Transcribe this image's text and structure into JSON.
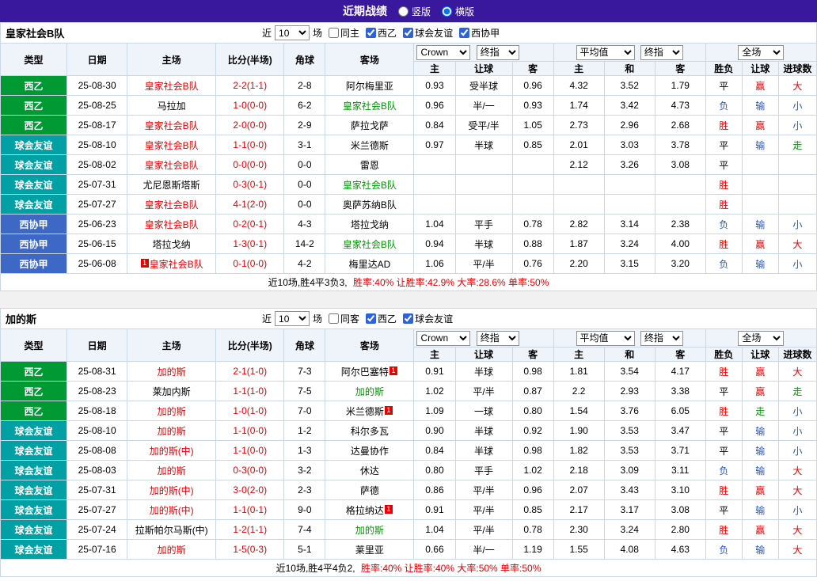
{
  "topbar": {
    "title": "近期战绩",
    "layout_options": [
      {
        "label": "竖版",
        "checked": false
      },
      {
        "label": "横版",
        "checked": true
      }
    ]
  },
  "filter_labels": {
    "near": "近",
    "games": "场"
  },
  "columns": {
    "type": "类型",
    "date": "日期",
    "home": "主场",
    "score": "比分(半场)",
    "corners": "角球",
    "away": "客场",
    "sub": [
      "主",
      "让球",
      "客",
      "主",
      "和",
      "客",
      "胜负",
      "让球",
      "进球数"
    ]
  },
  "header_controls": {
    "book": "Crown",
    "final": "终指",
    "average": "平均值",
    "full": "全场"
  },
  "colors": {
    "type_colors": {
      "西乙": "#009933",
      "球会友谊": "#00A0A5",
      "西协甲": "#3E68C6"
    },
    "palette": {
      "red": "#E60000",
      "blue": "#2255CC",
      "green": "#009900",
      "black": "#000000"
    },
    "outcome_color_map": {
      "胜": "red",
      "平": "black",
      "负": "blue",
      "赢": "red",
      "输": "blue",
      "走": "green",
      "大": "red",
      "小": "blue"
    }
  },
  "tables": [
    {
      "team": "皇家社会B队",
      "filter": {
        "games_value": "10",
        "same_label": "同主",
        "same_checked": false,
        "leagues": [
          {
            "label": "西乙",
            "checked": true
          },
          {
            "label": "球会友谊",
            "checked": true
          },
          {
            "label": "西协甲",
            "checked": true
          }
        ]
      },
      "rows": [
        {
          "type": "西乙",
          "date": "25-08-30",
          "home": {
            "name": "皇家社会B队",
            "focal": "home"
          },
          "score": "2-2(1-1)",
          "corners": "2-8",
          "away": {
            "name": "阿尔梅里亚"
          },
          "crown": [
            "0.93",
            "受半球",
            "0.96"
          ],
          "avg": [
            "4.32",
            "3.52",
            "1.79"
          ],
          "outcome": [
            "平",
            "赢",
            "大"
          ]
        },
        {
          "type": "西乙",
          "date": "25-08-25",
          "home": {
            "name": "马拉加"
          },
          "score": "1-0(0-0)",
          "corners": "6-2",
          "away": {
            "name": "皇家社会B队",
            "focal": "away"
          },
          "crown": [
            "0.96",
            "半/一",
            "0.93"
          ],
          "avg": [
            "1.74",
            "3.42",
            "4.73"
          ],
          "outcome": [
            "负",
            "输",
            "小"
          ]
        },
        {
          "type": "西乙",
          "date": "25-08-17",
          "home": {
            "name": "皇家社会B队",
            "focal": "home"
          },
          "score": "2-0(0-0)",
          "corners": "2-9",
          "away": {
            "name": "萨拉戈萨"
          },
          "crown": [
            "0.84",
            "受平/半",
            "1.05"
          ],
          "avg": [
            "2.73",
            "2.96",
            "2.68"
          ],
          "outcome": [
            "胜",
            "赢",
            "小"
          ]
        },
        {
          "type": "球会友谊",
          "date": "25-08-10",
          "home": {
            "name": "皇家社会B队",
            "focal": "home"
          },
          "score": "1-1(0-0)",
          "corners": "3-1",
          "away": {
            "name": "米兰德斯"
          },
          "crown": [
            "0.97",
            "半球",
            "0.85"
          ],
          "avg": [
            "2.01",
            "3.03",
            "3.78"
          ],
          "outcome": [
            "平",
            "输",
            "走"
          ]
        },
        {
          "type": "球会友谊",
          "date": "25-08-02",
          "home": {
            "name": "皇家社会B队",
            "focal": "home"
          },
          "score": "0-0(0-0)",
          "corners": "0-0",
          "away": {
            "name": "雷恩"
          },
          "crown": [
            "",
            "",
            ""
          ],
          "avg": [
            "2.12",
            "3.26",
            "3.08"
          ],
          "outcome": [
            "平",
            "",
            ""
          ]
        },
        {
          "type": "球会友谊",
          "date": "25-07-31",
          "home": {
            "name": "尤尼恩斯塔斯"
          },
          "score": "0-3(0-1)",
          "corners": "0-0",
          "away": {
            "name": "皇家社会B队",
            "focal": "away"
          },
          "crown": [
            "",
            "",
            ""
          ],
          "avg": [
            "",
            "",
            ""
          ],
          "outcome": [
            "胜",
            "",
            ""
          ]
        },
        {
          "type": "球会友谊",
          "date": "25-07-27",
          "home": {
            "name": "皇家社会B队",
            "focal": "home"
          },
          "score": "4-1(2-0)",
          "corners": "0-0",
          "away": {
            "name": "奥萨苏纳B队"
          },
          "crown": [
            "",
            "",
            ""
          ],
          "avg": [
            "",
            "",
            ""
          ],
          "outcome": [
            "胜",
            "",
            ""
          ]
        },
        {
          "type": "西协甲",
          "date": "25-06-23",
          "home": {
            "name": "皇家社会B队",
            "focal": "home"
          },
          "score": "0-2(0-1)",
          "corners": "4-3",
          "away": {
            "name": "塔拉戈纳"
          },
          "crown": [
            "1.04",
            "平手",
            "0.78"
          ],
          "avg": [
            "2.82",
            "3.14",
            "2.38"
          ],
          "outcome": [
            "负",
            "输",
            "小"
          ]
        },
        {
          "type": "西协甲",
          "date": "25-06-15",
          "home": {
            "name": "塔拉戈纳"
          },
          "score": "1-3(0-1)",
          "corners": "14-2",
          "away": {
            "name": "皇家社会B队",
            "focal": "away"
          },
          "crown": [
            "0.94",
            "半球",
            "0.88"
          ],
          "avg": [
            "1.87",
            "3.24",
            "4.00"
          ],
          "outcome": [
            "胜",
            "赢",
            "大"
          ]
        },
        {
          "type": "西协甲",
          "date": "25-06-08",
          "home": {
            "name": "皇家社会B队",
            "focal": "home",
            "badge": "1",
            "badge_pos": "before"
          },
          "score": "0-1(0-0)",
          "corners": "4-2",
          "away": {
            "name": "梅里达AD"
          },
          "crown": [
            "1.06",
            "平/半",
            "0.76"
          ],
          "avg": [
            "2.20",
            "3.15",
            "3.20"
          ],
          "outcome": [
            "负",
            "输",
            "小"
          ]
        }
      ],
      "footer": {
        "prefix": "近10场,胜4平3负3,",
        "stats": "胜率:40% 让胜率:42.9% 大率:28.6% 单率:50%"
      }
    },
    {
      "team": "加的斯",
      "filter": {
        "games_value": "10",
        "same_label": "同客",
        "same_checked": false,
        "leagues": [
          {
            "label": "西乙",
            "checked": true
          },
          {
            "label": "球会友谊",
            "checked": true
          }
        ]
      },
      "rows": [
        {
          "type": "西乙",
          "date": "25-08-31",
          "home": {
            "name": "加的斯",
            "focal": "home"
          },
          "score": "2-1(1-0)",
          "corners": "7-3",
          "away": {
            "name": "阿尔巴塞特",
            "badge": "1",
            "badge_pos": "after"
          },
          "crown": [
            "0.91",
            "半球",
            "0.98"
          ],
          "avg": [
            "1.81",
            "3.54",
            "4.17"
          ],
          "outcome": [
            "胜",
            "赢",
            "大"
          ]
        },
        {
          "type": "西乙",
          "date": "25-08-23",
          "home": {
            "name": "莱加内斯"
          },
          "score": "1-1(1-0)",
          "corners": "7-5",
          "away": {
            "name": "加的斯",
            "focal": "away"
          },
          "crown": [
            "1.02",
            "平/半",
            "0.87"
          ],
          "avg": [
            "2.2",
            "2.93",
            "3.38"
          ],
          "outcome": [
            "平",
            "赢",
            "走"
          ]
        },
        {
          "type": "西乙",
          "date": "25-08-18",
          "home": {
            "name": "加的斯",
            "focal": "home"
          },
          "score": "1-0(1-0)",
          "corners": "7-0",
          "away": {
            "name": "米兰德斯",
            "badge": "1",
            "badge_pos": "after"
          },
          "crown": [
            "1.09",
            "一球",
            "0.80"
          ],
          "avg": [
            "1.54",
            "3.76",
            "6.05"
          ],
          "outcome": [
            "胜",
            "走",
            "小"
          ]
        },
        {
          "type": "球会友谊",
          "date": "25-08-10",
          "home": {
            "name": "加的斯",
            "focal": "home"
          },
          "score": "1-1(0-0)",
          "corners": "1-2",
          "away": {
            "name": "科尔多瓦"
          },
          "crown": [
            "0.90",
            "半球",
            "0.92"
          ],
          "avg": [
            "1.90",
            "3.53",
            "3.47"
          ],
          "outcome": [
            "平",
            "输",
            "小"
          ]
        },
        {
          "type": "球会友谊",
          "date": "25-08-08",
          "home": {
            "name": "加的斯(中)",
            "focal": "home"
          },
          "score": "1-1(0-0)",
          "corners": "1-3",
          "away": {
            "name": "达曼协作"
          },
          "crown": [
            "0.84",
            "半球",
            "0.98"
          ],
          "avg": [
            "1.82",
            "3.53",
            "3.71"
          ],
          "outcome": [
            "平",
            "输",
            "小"
          ]
        },
        {
          "type": "球会友谊",
          "date": "25-08-03",
          "home": {
            "name": "加的斯",
            "focal": "home"
          },
          "score": "0-3(0-0)",
          "corners": "3-2",
          "away": {
            "name": "休达"
          },
          "crown": [
            "0.80",
            "平手",
            "1.02"
          ],
          "avg": [
            "2.18",
            "3.09",
            "3.11"
          ],
          "outcome": [
            "负",
            "输",
            "大"
          ]
        },
        {
          "type": "球会友谊",
          "date": "25-07-31",
          "home": {
            "name": "加的斯(中)",
            "focal": "home"
          },
          "score": "3-0(2-0)",
          "corners": "2-3",
          "away": {
            "name": "萨德"
          },
          "crown": [
            "0.86",
            "平/半",
            "0.96"
          ],
          "avg": [
            "2.07",
            "3.43",
            "3.10"
          ],
          "outcome": [
            "胜",
            "赢",
            "大"
          ]
        },
        {
          "type": "球会友谊",
          "date": "25-07-27",
          "home": {
            "name": "加的斯(中)",
            "focal": "home"
          },
          "score": "1-1(0-1)",
          "corners": "9-0",
          "away": {
            "name": "格拉纳达",
            "badge": "1",
            "badge_pos": "after"
          },
          "crown": [
            "0.91",
            "平/半",
            "0.85"
          ],
          "avg": [
            "2.17",
            "3.17",
            "3.08"
          ],
          "outcome": [
            "平",
            "输",
            "小"
          ]
        },
        {
          "type": "球会友谊",
          "date": "25-07-24",
          "home": {
            "name": "拉斯帕尔马斯(中)"
          },
          "score": "1-2(1-1)",
          "corners": "7-4",
          "away": {
            "name": "加的斯",
            "focal": "away"
          },
          "crown": [
            "1.04",
            "平/半",
            "0.78"
          ],
          "avg": [
            "2.30",
            "3.24",
            "2.80"
          ],
          "outcome": [
            "胜",
            "赢",
            "大"
          ]
        },
        {
          "type": "球会友谊",
          "date": "25-07-16",
          "home": {
            "name": "加的斯",
            "focal": "home"
          },
          "score": "1-5(0-3)",
          "corners": "5-1",
          "away": {
            "name": "莱里亚"
          },
          "crown": [
            "0.66",
            "半/一",
            "1.19"
          ],
          "avg": [
            "1.55",
            "4.08",
            "4.63"
          ],
          "outcome": [
            "负",
            "输",
            "大"
          ]
        }
      ],
      "footer": {
        "prefix": "近10场,胜4平4负2,",
        "stats": "胜率:40% 让胜率:40% 大率:50% 单率:50%"
      }
    }
  ]
}
